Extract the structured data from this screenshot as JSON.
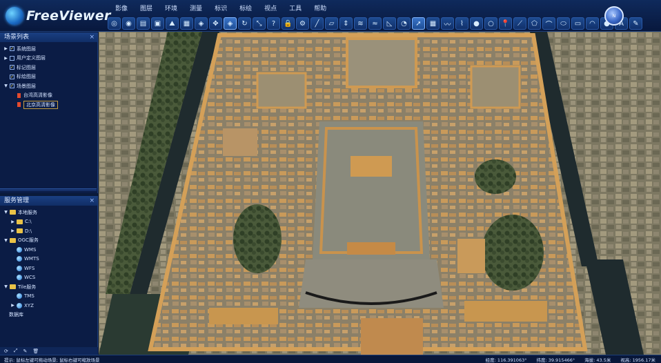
{
  "app": {
    "title": "FreeViewer"
  },
  "menu": [
    "影像",
    "图层",
    "环境",
    "测量",
    "标识",
    "标绘",
    "视点",
    "工具",
    "帮助"
  ],
  "compass_label": "N",
  "toolbar": {
    "icons": [
      "ogc-icon",
      "globe-icon",
      "layers-icon",
      "image-icon",
      "terrain-icon",
      "model-icon",
      "vector-icon",
      "pan-icon",
      "select-icon",
      "rotate-icon",
      "tilt-icon",
      "query-icon",
      "lock-icon",
      "settings-icon",
      "measure-line-icon",
      "measure-area-icon",
      "measure-height-icon",
      "profile-icon",
      "flood-icon",
      "slope-icon",
      "viewshed-icon",
      "cursor-icon",
      "grid-icon",
      "contour-icon",
      "path-icon",
      "record-icon",
      "circle-icon",
      "pin-icon",
      "polyline-icon",
      "polygon-icon",
      "curve-icon",
      "ellipse-icon",
      "rect-icon",
      "arc-icon",
      "sphere-icon",
      "text-icon",
      "brush-icon"
    ],
    "active_index": [
      8,
      21
    ]
  },
  "scene_panel": {
    "title": "场景列表",
    "items": [
      {
        "label": "系统图层",
        "level": 0,
        "caret": "▶",
        "checked": true,
        "kind": "folder"
      },
      {
        "label": "用户定义图层",
        "level": 0,
        "caret": "▶",
        "checked": false,
        "kind": "folder"
      },
      {
        "label": "标记图层",
        "level": 0,
        "caret": "",
        "checked": true,
        "kind": "folder"
      },
      {
        "label": "标绘图层",
        "level": 0,
        "caret": "",
        "checked": true,
        "kind": "folder"
      },
      {
        "label": "场景图层",
        "level": 0,
        "caret": "▼",
        "checked": true,
        "kind": "folder"
      },
      {
        "label": "台湾高清影像",
        "level": 1,
        "caret": "",
        "checked": false,
        "kind": "layer"
      },
      {
        "label": "北京高清影像",
        "level": 1,
        "caret": "",
        "checked": false,
        "kind": "layer",
        "selected": true
      }
    ]
  },
  "service_panel": {
    "title": "服务管理",
    "items": [
      {
        "label": "本地服务",
        "level": 0,
        "caret": "▼",
        "kind": "folder"
      },
      {
        "label": "C:\\",
        "level": 1,
        "caret": "▶",
        "kind": "folder"
      },
      {
        "label": "D:\\",
        "level": 1,
        "caret": "▶",
        "kind": "folder"
      },
      {
        "label": "OGC服务",
        "level": 0,
        "caret": "▼",
        "kind": "folder"
      },
      {
        "label": "WMS",
        "level": 1,
        "caret": "",
        "kind": "globe"
      },
      {
        "label": "WMTS",
        "level": 1,
        "caret": "",
        "kind": "globe"
      },
      {
        "label": "WFS",
        "level": 1,
        "caret": "",
        "kind": "globe"
      },
      {
        "label": "WCS",
        "level": 1,
        "caret": "",
        "kind": "globe"
      },
      {
        "label": "Tile服务",
        "level": 0,
        "caret": "▼",
        "kind": "folder"
      },
      {
        "label": "TMS",
        "level": 1,
        "caret": "",
        "kind": "globe"
      },
      {
        "label": "XYZ",
        "level": 1,
        "caret": "▶",
        "kind": "globe"
      },
      {
        "label": "数据库",
        "level": 0,
        "caret": "",
        "kind": "plain"
      }
    ]
  },
  "status": {
    "message": "提示: 鼠标左键可拖动场景; 鼠标右键可缩放场景",
    "lon": "经度: 116.391063°",
    "lat": "纬度: 39.915466°",
    "alt": "海拔: 43.5米",
    "view_alt": "视高: 1956.17米"
  }
}
